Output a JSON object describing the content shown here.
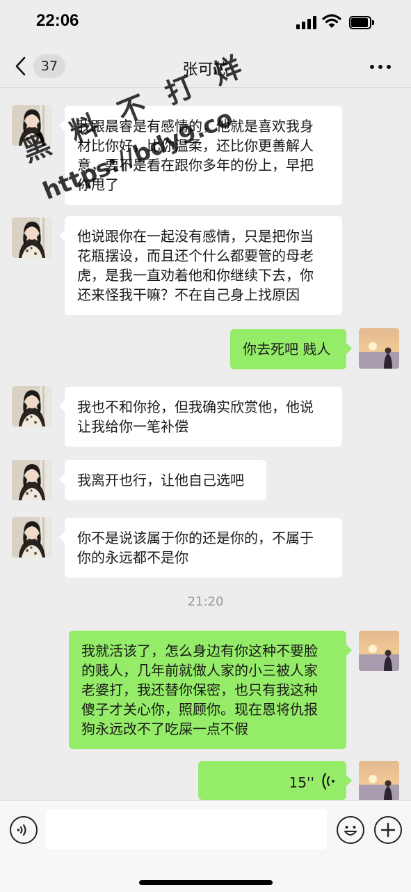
{
  "status_bar": {
    "time": "22:06"
  },
  "nav": {
    "back_icon": "chevron-left-icon",
    "unread_count": "37",
    "title": "张可芯",
    "more_icon": "more-horizontal-icon"
  },
  "messages": [
    {
      "side": "in",
      "lines": [
        "我跟晨睿是有感情的，他就是喜欢我身",
        "材比你好，比你温柔，还比你更善解人",
        "意，要不是看在跟你多年的份上，早把",
        "你甩了"
      ]
    },
    {
      "side": "in",
      "lines": [
        "他说跟你在一起没有感情，只是把你当",
        "花瓶摆设，而且还个什么都要管的母老",
        "虎，是我一直劝着他和你继续下去，你",
        "还来怪我干嘛？不在自己身上找原因"
      ]
    },
    {
      "side": "out",
      "lines": [
        "你去死吧 贱人"
      ]
    },
    {
      "side": "in",
      "lines": [
        "我也不和你抢，但我确实欣赏他，他说",
        "让我给你一笔补偿"
      ]
    },
    {
      "side": "in",
      "lines": [
        "我离开也行，让他自己选吧"
      ]
    },
    {
      "side": "in",
      "lines": [
        "你不是说该属于你的还是你的，不属于",
        "你的永远都不是你"
      ]
    },
    {
      "side": "out",
      "lines": [
        "我就活该了，怎么身边有你这种不要脸",
        "的贱人，几年前就做人家的小三被人家",
        "老婆打，我还替你保密，也只有我这种",
        "傻子才关心你，照顾你。现在恩将仇报",
        "狗永远改不了吃屎一点不假"
      ]
    },
    {
      "side": "out",
      "voice_duration": "15''"
    }
  ],
  "timestamp": "21:20",
  "watermark": {
    "line1": "黑 料 不 打 烊",
    "line2": "https://bdy9.co"
  },
  "input_bar": {
    "voice_icon": "voice-icon",
    "input_value": "",
    "emoji_icon": "emoji-icon",
    "plus_icon": "plus-icon"
  },
  "colors": {
    "incoming_bubble": "#ffffff",
    "outgoing_bubble": "#95ec69",
    "background": "#ededed"
  }
}
